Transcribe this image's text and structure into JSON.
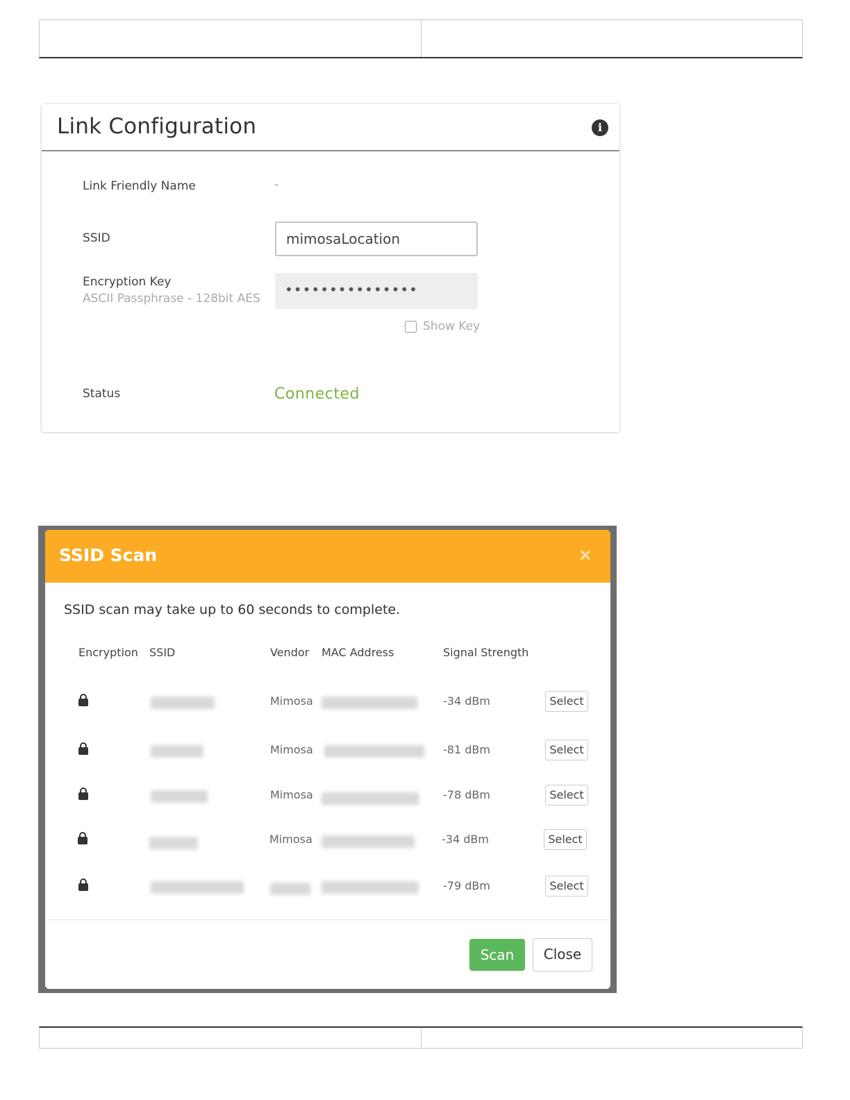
{
  "link_config": {
    "title": "Link Configuration",
    "friendly_name_label": "Link Friendly Name",
    "friendly_name_value": "-",
    "ssid_label": "SSID",
    "ssid_value": "mimosaLocation",
    "encryption_label": "Encryption Key",
    "encryption_sub": "ASCII Passphrase - 128bit AES",
    "encryption_value": "•••••••••••••••",
    "show_key_label": "Show Key",
    "status_label": "Status",
    "status_value": "Connected"
  },
  "ssid_scan": {
    "title": "SSID Scan",
    "close_symbol": "×",
    "note": "SSID scan may take up to 60 seconds to complete.",
    "columns": [
      "Encryption",
      "SSID",
      "Vendor",
      "MAC Address",
      "Signal Strength"
    ],
    "rows": [
      {
        "vendor": "Mimosa",
        "signal": "-34 dBm",
        "action": "Select"
      },
      {
        "vendor": "Mimosa",
        "signal": "-81 dBm",
        "action": "Select"
      },
      {
        "vendor": "Mimosa",
        "signal": "-78 dBm",
        "action": "Select"
      },
      {
        "vendor": "Mimosa",
        "signal": "-34 dBm",
        "action": "Select"
      },
      {
        "vendor": "",
        "signal": "-79 dBm",
        "action": "Select"
      }
    ],
    "scan_label": "Scan",
    "close_label": "Close"
  },
  "colors": {
    "modal_header": "#fbab24",
    "status_connected": "#7cb342",
    "scan_button": "#5cb85c"
  }
}
